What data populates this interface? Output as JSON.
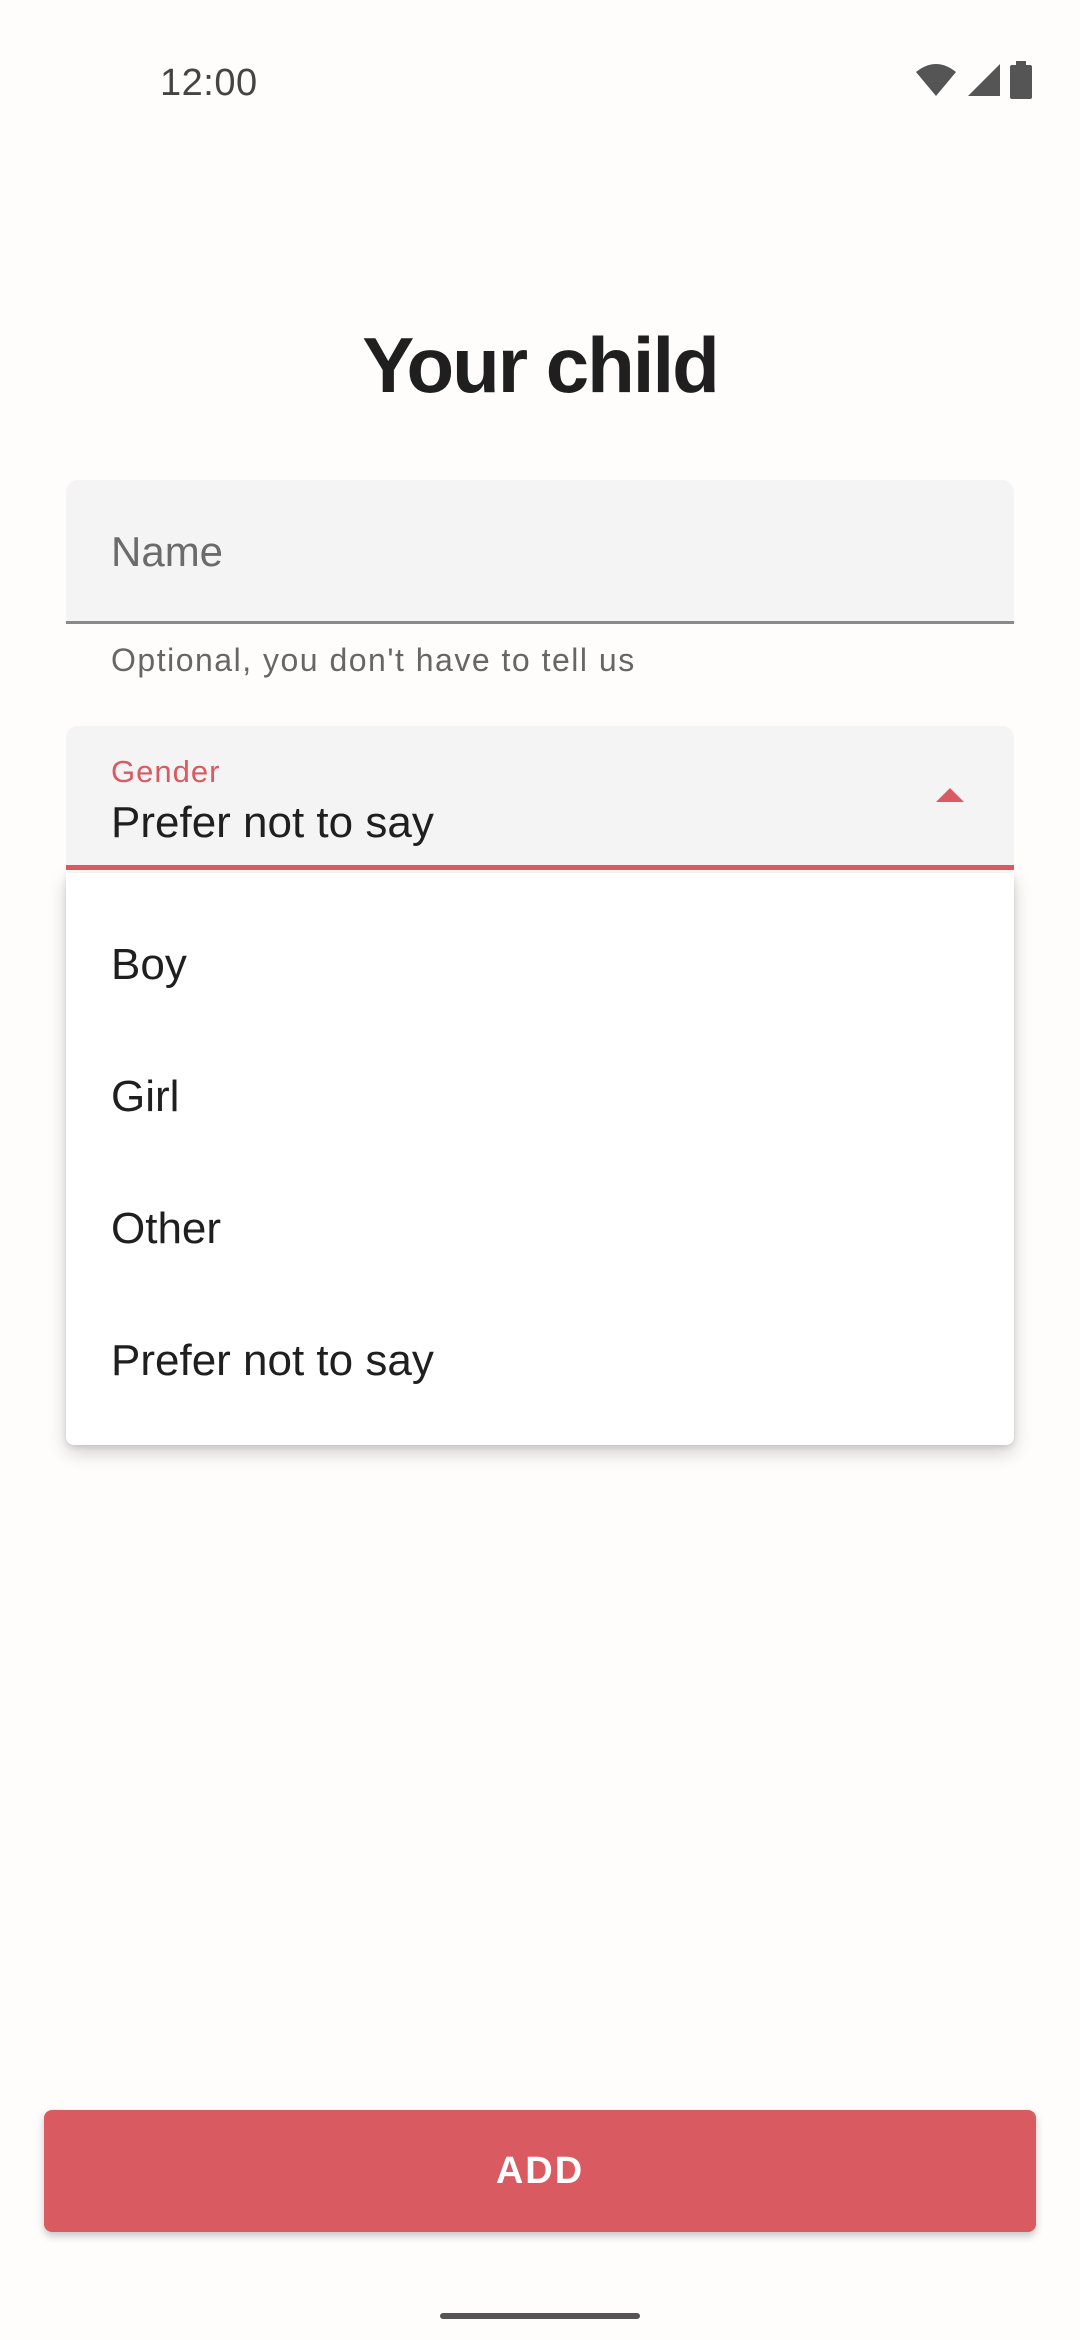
{
  "status_bar": {
    "time": "12:00",
    "icons": [
      "wifi-icon",
      "cell-signal-icon",
      "battery-icon"
    ]
  },
  "page": {
    "title": "Your child"
  },
  "name_field": {
    "placeholder": "Name",
    "value": "",
    "helper": "Optional, you don't have to tell us"
  },
  "gender_field": {
    "label": "Gender",
    "selected": "Prefer not to say",
    "expanded": true,
    "options": [
      "Boy",
      "Girl",
      "Other",
      "Prefer not to say"
    ]
  },
  "actions": {
    "add_label": "ADD"
  },
  "colors": {
    "accent": "#d95b61",
    "field_background": "#f4f4f4",
    "page_background": "#fffcfc",
    "text_primary": "#1f1f1f"
  }
}
